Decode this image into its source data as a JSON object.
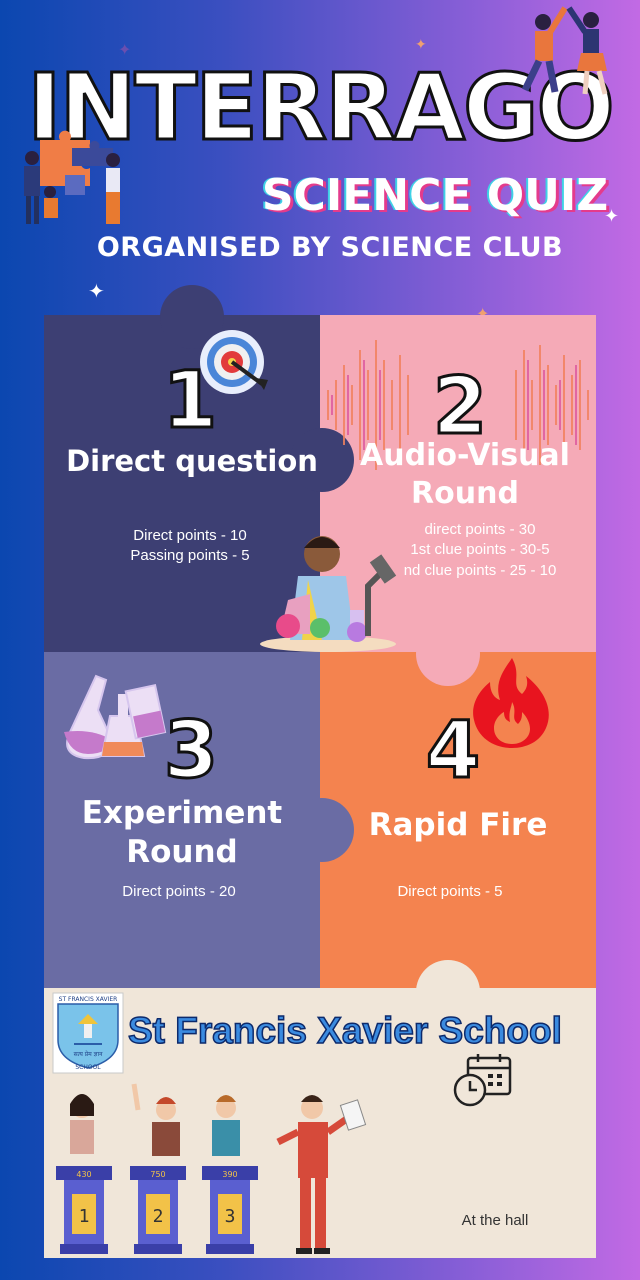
{
  "header": {
    "title": "INTERRAGO",
    "subtitle": "SCIENCE QUIZ",
    "organiser": "ORGANISED BY SCIENCE CLUB"
  },
  "rounds": [
    {
      "number": "1",
      "title_lines": [
        "Direct question"
      ],
      "points": [
        "Direct points - 10",
        "Passing points - 5"
      ],
      "color": "#3d3f73",
      "icon": "target-icon"
    },
    {
      "number": "2",
      "title_lines": [
        "Audio-Visual",
        "Round"
      ],
      "points": [
        "direct points - 30",
        "1st clue points - 30-5",
        "nd clue points - 25 - 10"
      ],
      "color": "#f5aab7",
      "icon": "sound-wave-icon"
    },
    {
      "number": "3",
      "title_lines": [
        "Experiment",
        "Round"
      ],
      "points": [
        "Direct points - 20"
      ],
      "color": "#6a6ca4",
      "icon": "flask-icon"
    },
    {
      "number": "4",
      "title_lines": [
        "Rapid Fire"
      ],
      "points": [
        "Direct points - 5"
      ],
      "color": "#f4834f",
      "icon": "fire-icon"
    }
  ],
  "footer": {
    "school_name": "St Francis Xavier School",
    "logo_top_text": "ST FRANCIS XAVIER",
    "logo_motto": "सत्य प्रेम ज्ञान",
    "logo_bottom_text": "SCHOOL",
    "venue": "At the hall",
    "podium_scores": [
      "430",
      "750",
      "390"
    ],
    "podium_numbers": [
      "1",
      "2",
      "3"
    ],
    "icons": [
      "calendar-clock-icon",
      "school-logo-icon"
    ]
  }
}
